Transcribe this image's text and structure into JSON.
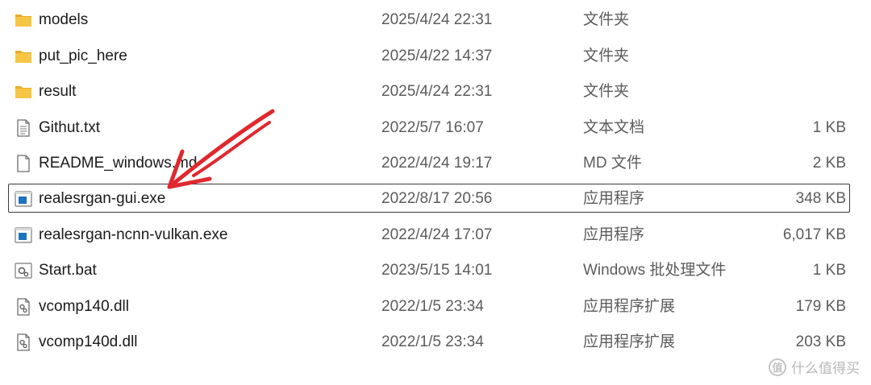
{
  "files": [
    {
      "name": "models",
      "date": "2025/4/24 22:31",
      "type": "文件夹",
      "size": "",
      "icon": "folder-icon"
    },
    {
      "name": "put_pic_here",
      "date": "2025/4/22 14:37",
      "type": "文件夹",
      "size": "",
      "icon": "folder-icon"
    },
    {
      "name": "result",
      "date": "2025/4/24 22:31",
      "type": "文件夹",
      "size": "",
      "icon": "folder-icon"
    },
    {
      "name": "Githut.txt",
      "date": "2022/5/7 16:07",
      "type": "文本文档",
      "size": "1 KB",
      "icon": "text-file-icon"
    },
    {
      "name": "README_windows.md",
      "date": "2022/4/24 19:17",
      "type": "MD 文件",
      "size": "2 KB",
      "icon": "blank-file-icon"
    },
    {
      "name": "realesrgan-gui.exe",
      "date": "2022/8/17 20:56",
      "type": "应用程序",
      "size": "348 KB",
      "icon": "application-icon",
      "selected": true
    },
    {
      "name": "realesrgan-ncnn-vulkan.exe",
      "date": "2022/4/24 17:07",
      "type": "应用程序",
      "size": "6,017 KB",
      "icon": "application-icon"
    },
    {
      "name": "Start.bat",
      "date": "2023/5/15 14:01",
      "type": "Windows 批处理文件",
      "size": "1 KB",
      "icon": "batch-file-icon"
    },
    {
      "name": "vcomp140.dll",
      "date": "2022/1/5 23:34",
      "type": "应用程序扩展",
      "size": "179 KB",
      "icon": "dll-file-icon"
    },
    {
      "name": "vcomp140d.dll",
      "date": "2022/1/5 23:34",
      "type": "应用程序扩展",
      "size": "203 KB",
      "icon": "dll-file-icon"
    }
  ],
  "watermark": {
    "logo": "值",
    "text": "什么值得买"
  },
  "colors": {
    "folder": "#f6c544",
    "folder_back": "#e8aa25",
    "app_blue": "#1e73be",
    "arrow": "#e0282e",
    "selection_border": "#3a3a3a"
  }
}
